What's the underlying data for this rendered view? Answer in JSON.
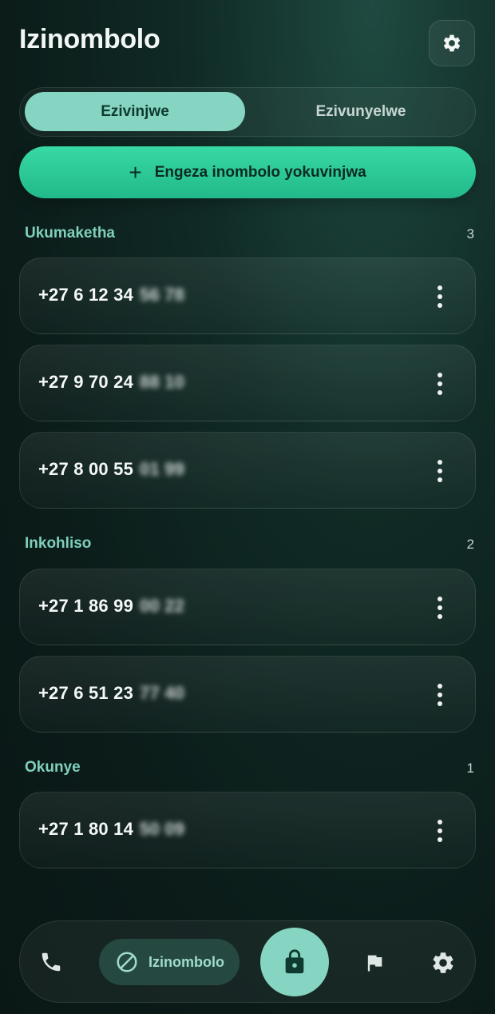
{
  "header": {
    "title": "Izinombolo",
    "settings_icon": "gear-icon"
  },
  "tabs": [
    {
      "label": "Ezivinjwe",
      "active": true
    },
    {
      "label": "Ezivunyelwe",
      "active": false
    }
  ],
  "add_button": {
    "label": "Engeza inombolo yokuvinjwa",
    "icon": "plus-icon"
  },
  "sections": [
    {
      "title": "Ukumaketha",
      "count": "3",
      "items": [
        {
          "visible": "+27 6 12 34",
          "hidden": "56 78"
        },
        {
          "visible": "+27 9 70 24",
          "hidden": "88 10"
        },
        {
          "visible": "+27 8 00 55",
          "hidden": "01 99"
        }
      ]
    },
    {
      "title": "Inkohliso",
      "count": "2",
      "items": [
        {
          "visible": "+27 1 86 99",
          "hidden": "00 22"
        },
        {
          "visible": "+27 6 51 23",
          "hidden": "77 40"
        }
      ]
    },
    {
      "title": "Okunye",
      "count": "1",
      "items": [
        {
          "visible": "+27 1 80 14",
          "hidden": "50 09"
        }
      ]
    }
  ],
  "bottom_nav": {
    "items": [
      {
        "icon": "phone-icon"
      },
      {
        "icon": "block-icon",
        "label": "Izinombolo",
        "active": true
      },
      {
        "icon": "lock-icon"
      },
      {
        "icon": "flag-icon"
      },
      {
        "icon": "gear-icon"
      }
    ]
  },
  "colors": {
    "accent": "#86d5c2",
    "primary_button": "#2cc998",
    "section_title": "#7fd0bc",
    "background": "#0f2622"
  }
}
